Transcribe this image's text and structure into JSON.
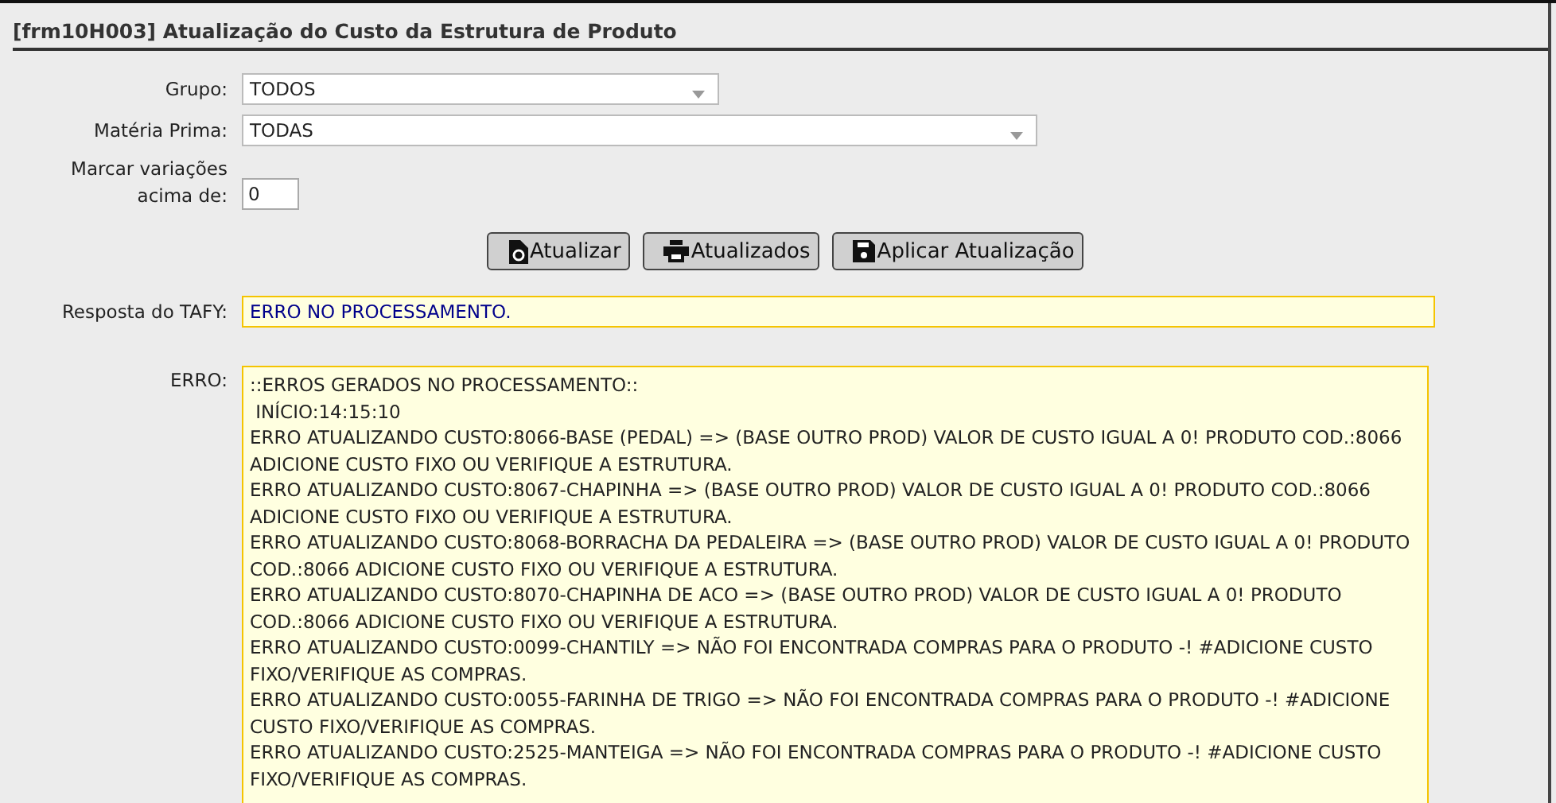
{
  "form": {
    "title": "[frm10H003] Atualização do Custo da Estrutura de Produto"
  },
  "filters": [
    {
      "label": "Grupo:",
      "value": "TODOS",
      "kind": "select"
    },
    {
      "label": "Matéria Prima:",
      "value": "TODAS",
      "kind": "select"
    },
    {
      "label": "Marcar variações acima de:",
      "value": "0",
      "kind": "input"
    }
  ],
  "buttons": [
    {
      "label": "Atualizar"
    },
    {
      "label": "Atualizados"
    },
    {
      "label": "Aplicar Atualização"
    }
  ],
  "response": {
    "label": "Resposta do TAFY:",
    "value": "ERRO NO PROCESSAMENTO."
  },
  "errors": {
    "label": "ERRO:",
    "lines": [
      "::ERROS GERADOS NO PROCESSAMENTO::",
      " INÍCIO:14:15:10",
      "ERRO ATUALIZANDO CUSTO:8066-BASE (PEDAL) => (BASE OUTRO PROD) VALOR DE CUSTO IGUAL A 0! PRODUTO COD.:8066 ADICIONE CUSTO FIXO OU VERIFIQUE A ESTRUTURA.",
      "ERRO ATUALIZANDO CUSTO:8067-CHAPINHA => (BASE OUTRO PROD) VALOR DE CUSTO IGUAL A 0! PRODUTO COD.:8066 ADICIONE CUSTO FIXO OU VERIFIQUE A ESTRUTURA.",
      "ERRO ATUALIZANDO CUSTO:8068-BORRACHA DA PEDALEIRA => (BASE OUTRO PROD) VALOR DE CUSTO IGUAL A 0! PRODUTO COD.:8066 ADICIONE CUSTO FIXO OU VERIFIQUE A ESTRUTURA.",
      "ERRO ATUALIZANDO CUSTO:8070-CHAPINHA DE ACO => (BASE OUTRO PROD) VALOR DE CUSTO IGUAL A 0! PRODUTO COD.:8066 ADICIONE CUSTO FIXO OU VERIFIQUE A ESTRUTURA.",
      "ERRO ATUALIZANDO CUSTO:0099-CHANTILY => NÃO FOI ENCONTRADA COMPRAS PARA O PRODUTO -! #ADICIONE CUSTO FIXO/VERIFIQUE AS COMPRAS.",
      "ERRO ATUALIZANDO CUSTO:0055-FARINHA DE TRIGO => NÃO FOI ENCONTRADA COMPRAS PARA O PRODUTO -! #ADICIONE CUSTO FIXO/VERIFIQUE AS COMPRAS.",
      "ERRO ATUALIZANDO CUSTO:2525-MANTEIGA => NÃO FOI ENCONTRADA COMPRAS PARA O PRODUTO -! #ADICIONE CUSTO FIXO/VERIFIQUE AS COMPRAS."
    ]
  }
}
